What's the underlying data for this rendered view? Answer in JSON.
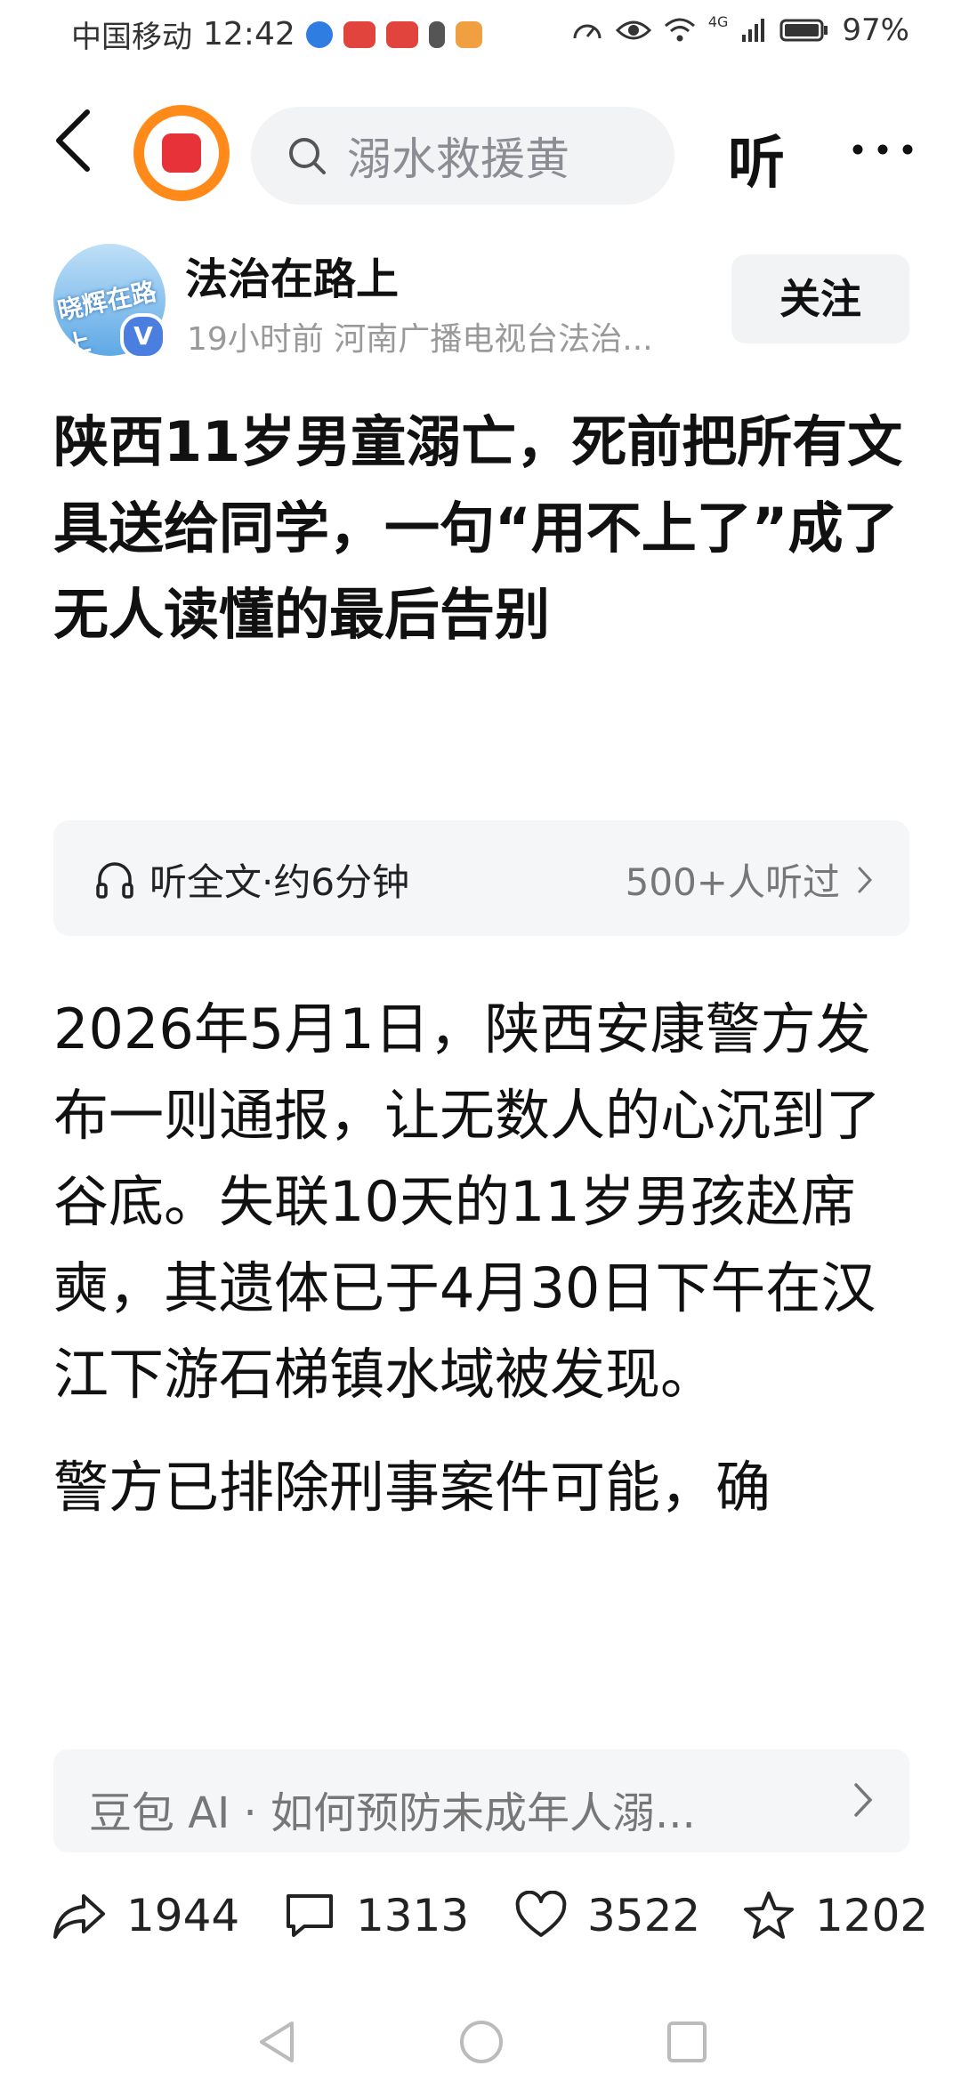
{
  "status": {
    "carrier": "中国移动",
    "time": "12:42",
    "network": "4G",
    "battery": "97%"
  },
  "nav": {
    "search_placeholder": "溺水救援黄",
    "listen_label": "听"
  },
  "author": {
    "name": "法治在路上",
    "avatar_text": "晓辉在路上",
    "verified": "V",
    "meta": "19小时前  河南广播电视台法治...",
    "follow_label": "关注"
  },
  "article": {
    "title": "陕西11岁男童溺亡，死前把所有文具送给同学，一句“用不上了”成了无人读懂的最后告别",
    "listen": {
      "label": "听全文·约6分钟",
      "count": "500+人听过"
    },
    "paragraphs": [
      "2026年5月1日，陕西安康警方发布一则通报，让无数人的心沉到了谷底。失联10天的11岁男孩赵席奭，其遗体已于4月30日下午在汉江下游石梯镇水域被发现。",
      "警方已排除刑事案件可能，确"
    ]
  },
  "ai_bar": {
    "text": "豆包 AI · 如何预防未成年人溺..."
  },
  "actions": {
    "share": "1944",
    "comment": "1313",
    "like": "3522",
    "favorite": "1202"
  }
}
